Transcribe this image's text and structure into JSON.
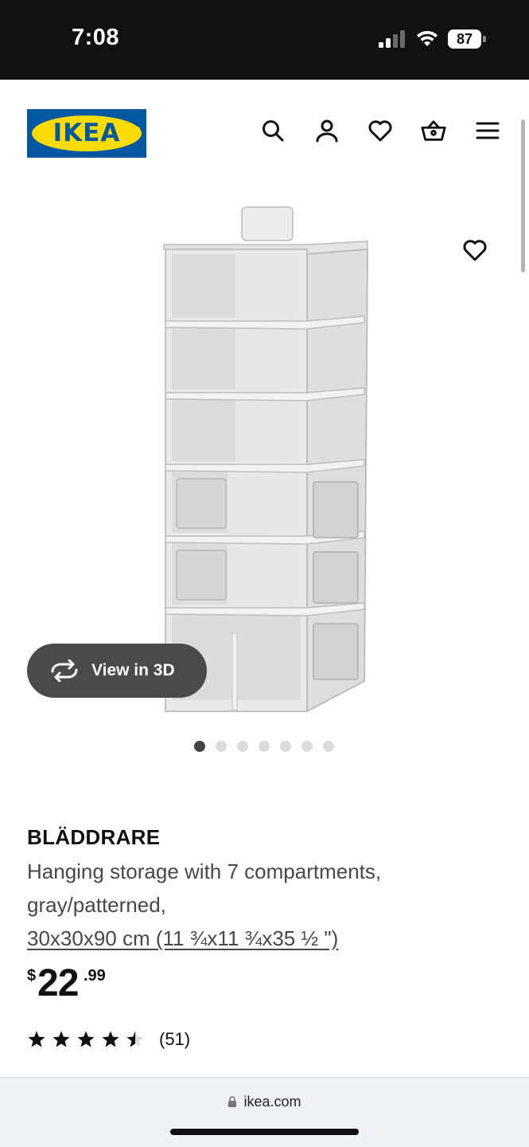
{
  "status_bar": {
    "time": "7:08",
    "battery_level": "87",
    "signal_icon": "cellular-signal-icon",
    "wifi_icon": "wifi-icon"
  },
  "header": {
    "logo_text": "IKEA",
    "brand_colors": {
      "blue": "#0058a3",
      "yellow": "#ffdb00"
    },
    "icons": [
      "search-icon",
      "account-icon",
      "favorites-heart-icon",
      "shopping-bag-icon",
      "menu-hamburger-icon"
    ]
  },
  "gallery": {
    "view_3d_label": "View in 3D",
    "favorite_icon": "heart-outline-icon",
    "image_count": 7,
    "active_index": 0
  },
  "product": {
    "name": "BLÄDDRARE",
    "description": "Hanging storage with 7 compartments, gray/patterned,",
    "size": "30x30x90 cm (11 ¾x11 ¾x35 ½ \")",
    "price_currency": "$",
    "price_integer": "22",
    "price_decimal": ".99",
    "rating": 4.5,
    "rating_count": "(51)"
  },
  "browser": {
    "url": "ikea.com"
  }
}
